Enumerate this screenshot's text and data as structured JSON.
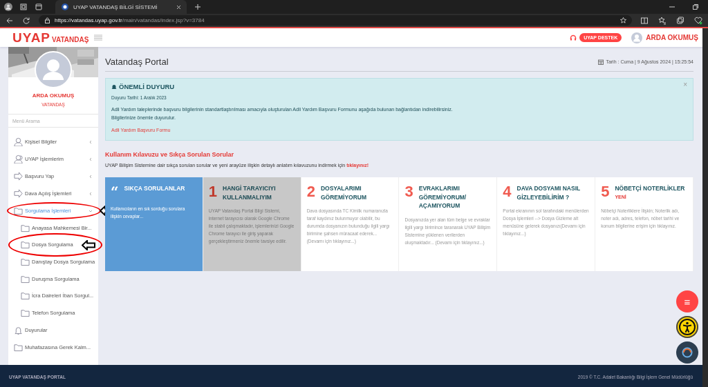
{
  "browser": {
    "tab_title": "UYAP VATANDAŞ BİLGİ SİSTEMİ",
    "url_host": "https://vatandas.uyap.gov.tr",
    "url_path": "/main/vatandas/index.jsp?v=3784"
  },
  "header": {
    "logo": "UYAP",
    "logo_sub": "VATANDAŞ",
    "support": "UYAP DESTEK",
    "user": "ARDA OKUMUŞ"
  },
  "sidebar": {
    "name": "ARDA OKUMUŞ",
    "role": "VATANDAŞ",
    "search_placeholder": "Menü Arama",
    "items": [
      {
        "label": "Kişisel Bilgiler",
        "kind": "user",
        "expanded": false,
        "selected": false,
        "annotated": false
      },
      {
        "label": "UYAP İşlemlerim",
        "kind": "users",
        "expanded": false,
        "selected": false,
        "annotated": false
      },
      {
        "label": "Başvuru Yap",
        "kind": "arrow",
        "expanded": false,
        "selected": false,
        "annotated": false
      },
      {
        "label": "Dava Açılış İşlemleri",
        "kind": "arrow",
        "expanded": false,
        "selected": false,
        "annotated": false
      },
      {
        "label": "Sorgulama İşlemleri",
        "kind": "folder",
        "expanded": true,
        "selected": true,
        "annotated": true,
        "children": [
          {
            "label": "Anayasa Mahkemesi Bir...",
            "annotated": false
          },
          {
            "label": "Dosya Sorgulama",
            "annotated": true
          },
          {
            "label": "Danıştay Dosya Sorgulama",
            "annotated": false
          },
          {
            "label": "Duruşma Sorgulama",
            "annotated": false
          },
          {
            "label": "İcra Daireleri İban Sorgul...",
            "annotated": false
          },
          {
            "label": "Telefon Sorgulama",
            "annotated": false
          }
        ]
      },
      {
        "label": "Duyurular",
        "kind": "bell",
        "selected": false,
        "annotated": false
      },
      {
        "label": "Muhafazasına Gerek Kalm...",
        "kind": "folder",
        "selected": false,
        "annotated": false
      }
    ]
  },
  "page": {
    "title": "Vatandaş Portal",
    "date": "Tarih : Cuma | 9 Ağustos 2024 | 15:25:54",
    "notice": {
      "title": "ÖNEMLİ DUYURU",
      "date_line": "Duyuru Tarihi: 1 Aralık 2023",
      "body": "Adli Yardım taleplerinde başvuru bilgilerinin standartlaştırılması amacıyla oluşturulan Adli Yardım Başvuru Formunu aşağıda bulunan bağlantıdan indirebilirsiniz.",
      "body2": "Bilgilerinize önemle duyurulur.",
      "link": "Adli Yardım Başvuru Formu",
      "close": "×"
    },
    "guide": {
      "title": "Kullanım Kılavuzu ve Sıkça Sorulan Sorular",
      "text": "UYAP Bilişim Sistemine dair sıkça sorulan sorular ve yeni arayüze ilişkin detaylı anlatım kılavuzunu indirmek için",
      "link": "tıklayınız!"
    },
    "cards": [
      {
        "kind": "featured",
        "mark": "“",
        "title": "SIKÇA SORULANLAR",
        "text": "Kullanıcıların en sık sorduğu sorulara ilişkin cevaplar...",
        "hovered": false
      },
      {
        "kind": "numbered",
        "mark": "1",
        "title": "HANGİ TARAYICIYI KULLANMALIYIM",
        "text": "UYAP Vatandaş Portal Bilgi Sistemi, internet tarayıcısı olarak Google Chrome ile stabil çalışmaktadır, işlemlerinizi Google Chrome tarayıcı ile giriş yaparak gerçekleştirmeniz önemle tavsiye edilir.",
        "hovered": true
      },
      {
        "kind": "numbered",
        "mark": "2",
        "title": "DOSYALARIMI GÖREMİYORUM",
        "text": "Dava dosyasında TC Kimlik numaranızla taraf kaydınız bulunmuyor olabilir, bu durumda dosyanızın bulunduğu ilgili yargı birimine şahsen müracaat ederek... (Devamı için tıklayınız...)",
        "hovered": false
      },
      {
        "kind": "numbered",
        "mark": "3",
        "title": "EVRAKLARIMI GÖREMİYORUM/ AÇAMIYORUM",
        "text": "Dosyanızda yer alan tüm belge ve evraklar ilgili yargı birimince taranarak UYAP Bilişim Sistemine yüklenen verilerden oluşmaktadır... (Devamı için tıklayınız...)",
        "hovered": false
      },
      {
        "kind": "numbered",
        "mark": "4",
        "title": "DAVA DOSYAMI NASIL GİZLEYEBİLİRİM ?",
        "text": "Portal ekranının sol tarafındaki menülerden Dosya İşlemleri --> Dosya Gizleme alt menüsüne gelerek dosyanızı(Devamı için tıklayınız...)",
        "hovered": false
      },
      {
        "kind": "numbered",
        "mark": "5",
        "title": "NÖBETÇİ NOTERLİKLER",
        "badge": "YENİ",
        "text": "Nöbetçi Noterliklere İlişkin; Noterlik adı, noter adı, adres, telefon, nöbet tarihi ve konum bilgilerine erişim için tıklayınız.",
        "hovered": false
      }
    ]
  },
  "fab": {
    "menu": "≡"
  },
  "footer": {
    "left": "UYAP VATANDAŞ PORTAL",
    "right": "2019 © T.C. Adalet Bakanlığı Bilgi İşlem Genel Müdürlüğü"
  }
}
